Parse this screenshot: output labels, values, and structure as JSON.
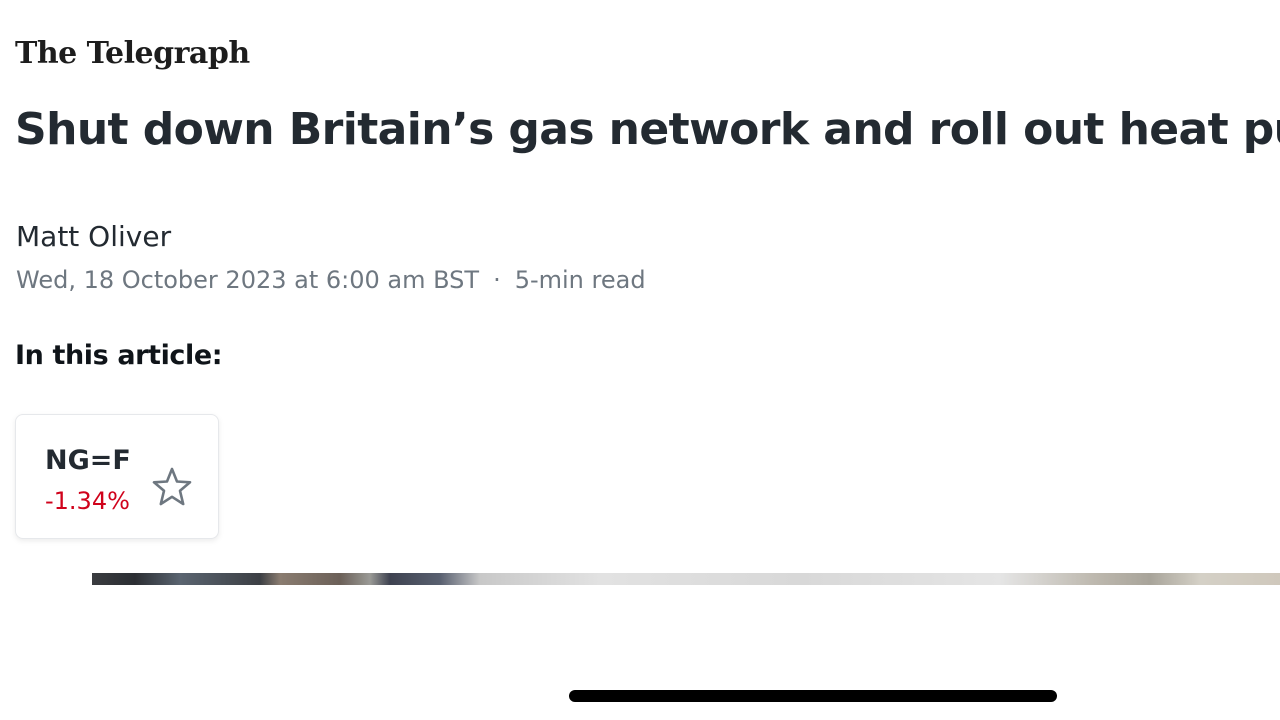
{
  "publisher": {
    "logo_text": "The Telegraph"
  },
  "article": {
    "headline": "Shut down Britain’s gas network and roll out heat pumps",
    "author": "Matt Oliver",
    "date": "Wed, 18 October 2023 at 6:00 am BST",
    "separator": "·",
    "read_time": "5-min read"
  },
  "in_this_article": {
    "heading": "In this article:",
    "tickers": [
      {
        "symbol": "NG=F",
        "change": "-1.34%",
        "change_color": "#d0021b",
        "icon": "star-outline-icon"
      }
    ]
  },
  "colors": {
    "headline": "#232a31",
    "meta": "#6e7780",
    "negative": "#d0021b"
  }
}
